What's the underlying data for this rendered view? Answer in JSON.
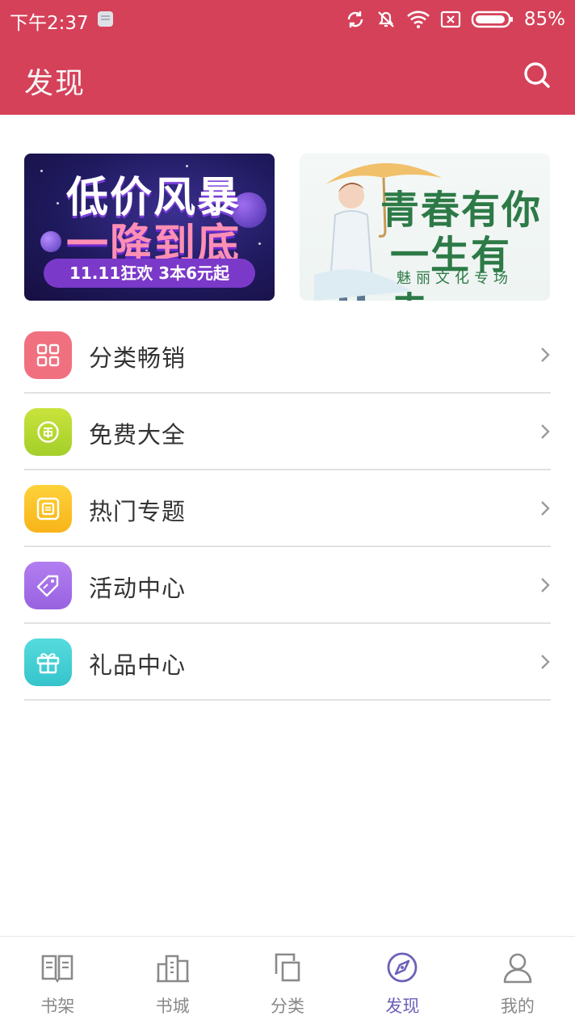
{
  "status_bar": {
    "time": "下午2:37",
    "battery": "85%"
  },
  "header": {
    "title": "发现",
    "accent_color": "#d54159"
  },
  "banners": [
    {
      "line1": "低价风暴",
      "line2": "一降到底",
      "pill": "11.11狂欢  3本6元起"
    },
    {
      "line1": "青春有你",
      "line2": "一生有幸",
      "sub": "魅丽文化专场"
    }
  ],
  "menu": {
    "items": [
      {
        "label": "分类畅销",
        "icon": "grid-icon",
        "color": "#f0707f"
      },
      {
        "label": "免费大全",
        "icon": "free-icon",
        "color": "#b4d82c"
      },
      {
        "label": "热门专题",
        "icon": "topic-icon",
        "color": "#fbbd21"
      },
      {
        "label": "活动中心",
        "icon": "tag-icon",
        "color": "#a470e6"
      },
      {
        "label": "礼品中心",
        "icon": "gift-icon",
        "color": "#43cfd3"
      }
    ]
  },
  "bottom_nav": {
    "items": [
      {
        "label": "书架",
        "icon": "bookshelf-icon"
      },
      {
        "label": "书城",
        "icon": "bookstore-icon"
      },
      {
        "label": "分类",
        "icon": "category-icon"
      },
      {
        "label": "发现",
        "icon": "compass-icon",
        "active": true
      },
      {
        "label": "我的",
        "icon": "profile-icon"
      }
    ],
    "active_color": "#6b61b8"
  }
}
